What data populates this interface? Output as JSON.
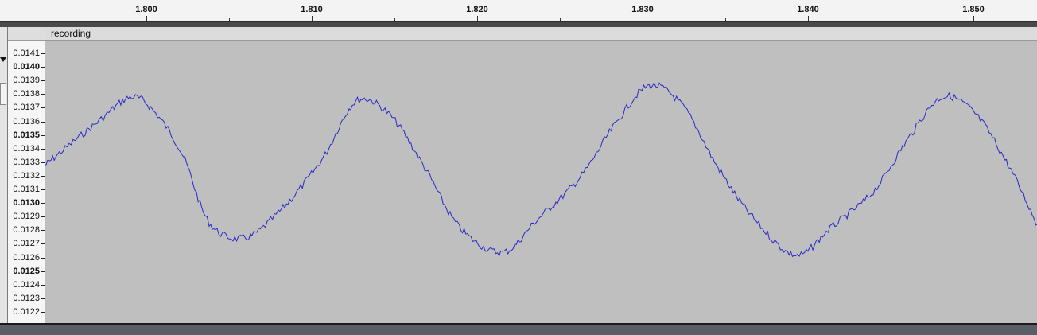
{
  "timeline": {
    "labels": [
      "1.800",
      "1.810",
      "1.820",
      "1.830",
      "1.840",
      "1.850"
    ]
  },
  "track": {
    "name": "recording"
  },
  "amplitude_ruler": {
    "labels": [
      "0.0141",
      "0.0140",
      "0.0139",
      "0.0138",
      "0.0137",
      "0.0136",
      "0.0135",
      "0.0134",
      "0.0133",
      "0.0132",
      "0.0131",
      "0.0130",
      "0.0129",
      "0.0128",
      "0.0127",
      "0.0126",
      "0.0125",
      "0.0124",
      "0.0123",
      "0.0122"
    ],
    "bold_labels": [
      "0.0140",
      "0.0135",
      "0.0130",
      "0.0125"
    ]
  },
  "colors": {
    "waveform": "#2a2ac8",
    "background": "#bfbfbf"
  },
  "chart_data": {
    "type": "line",
    "x": [
      1.7955,
      1.7985,
      1.8005,
      1.802,
      1.8035,
      1.805,
      1.807,
      1.809,
      1.8115,
      1.8135,
      1.8155,
      1.8175,
      1.8195,
      1.822,
      1.824,
      1.8265,
      1.8285,
      1.8305,
      1.8325,
      1.8345,
      1.8365,
      1.839,
      1.841,
      1.8435,
      1.8455,
      1.8475,
      1.8495,
      1.8515,
      1.853
    ],
    "y": [
      0.01327,
      0.01357,
      0.01375,
      0.01362,
      0.01333,
      0.01286,
      0.01275,
      0.01293,
      0.0133,
      0.01372,
      0.01362,
      0.01325,
      0.01283,
      0.01265,
      0.01288,
      0.01318,
      0.01355,
      0.01383,
      0.01368,
      0.01325,
      0.0129,
      0.01263,
      0.01282,
      0.01308,
      0.01345,
      0.01375,
      0.01362,
      0.01323,
      0.01285
    ],
    "xlim": [
      1.7955,
      1.853
    ],
    "ylim": [
      0.01215,
      0.01415
    ]
  }
}
